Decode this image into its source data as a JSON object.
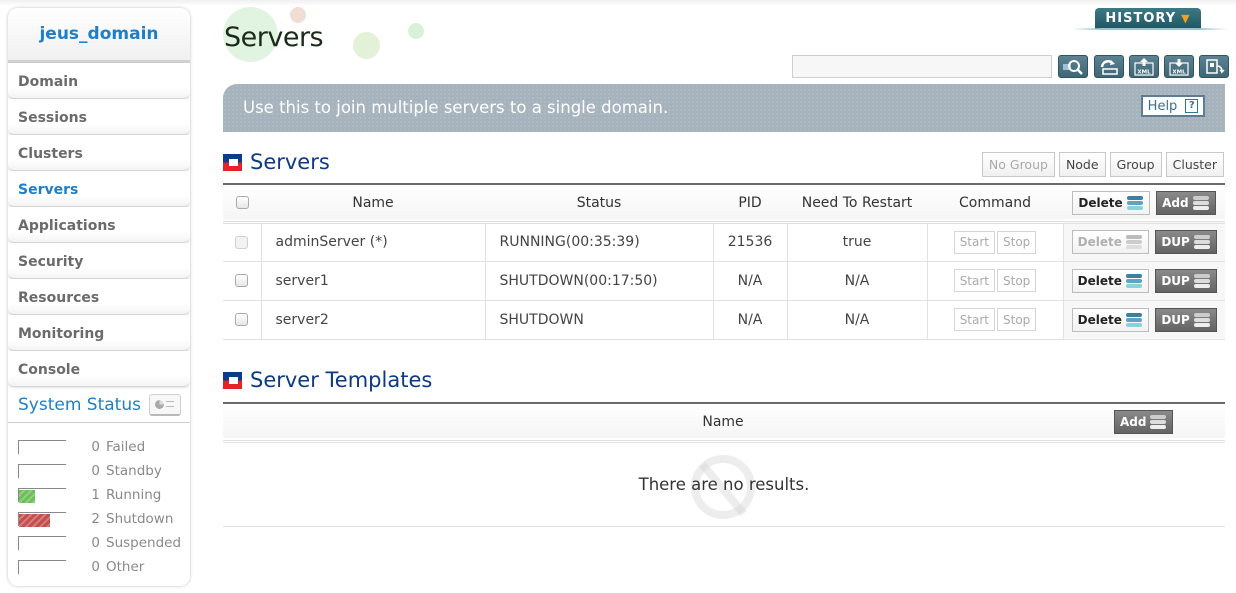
{
  "sidebar": {
    "domain_name": "jeus_domain",
    "items": [
      {
        "label": "Domain",
        "active": false
      },
      {
        "label": "Sessions",
        "active": false
      },
      {
        "label": "Clusters",
        "active": false
      },
      {
        "label": "Servers",
        "active": true
      },
      {
        "label": "Applications",
        "active": false
      },
      {
        "label": "Security",
        "active": false
      },
      {
        "label": "Resources",
        "active": false
      },
      {
        "label": "Monitoring",
        "active": false
      },
      {
        "label": "Console",
        "active": false
      }
    ],
    "system_status": {
      "title": "System Status",
      "icon": "monitor-chart-icon",
      "rows": [
        {
          "count": "0",
          "label": "Failed",
          "fraction": 0,
          "color": "none"
        },
        {
          "count": "0",
          "label": "Standby",
          "fraction": 0,
          "color": "none"
        },
        {
          "count": "1",
          "label": "Running",
          "fraction": 0.333,
          "color": "#6cbf58"
        },
        {
          "count": "2",
          "label": "Shutdown",
          "fraction": 0.667,
          "color": "#c44d4d"
        },
        {
          "count": "0",
          "label": "Suspended",
          "fraction": 0,
          "color": "none"
        },
        {
          "count": "0",
          "label": "Other",
          "fraction": 0,
          "color": "none"
        }
      ]
    }
  },
  "header": {
    "page_title": "Servers",
    "history_label": "HISTORY",
    "search": {
      "value": "",
      "placeholder": ""
    },
    "toolbar": [
      {
        "icon": "search-icon"
      },
      {
        "icon": "refresh-icon"
      },
      {
        "icon": "xml-export-icon",
        "text": "XML"
      },
      {
        "icon": "xml-import-icon",
        "text": "XML"
      },
      {
        "icon": "apply-changes-icon"
      }
    ]
  },
  "banner": {
    "text": "Use this to join multiple servers to a single domain.",
    "help_label": "Help",
    "help_icon": "?"
  },
  "servers_section": {
    "title": "Servers",
    "group_buttons": [
      {
        "label": "No Group",
        "disabled": true
      },
      {
        "label": "Node",
        "disabled": false
      },
      {
        "label": "Group",
        "disabled": false
      },
      {
        "label": "Cluster",
        "disabled": false
      }
    ],
    "columns": [
      "Name",
      "Status",
      "PID",
      "Need To Restart",
      "Command"
    ],
    "delete_label": "Delete",
    "add_label": "Add",
    "start_label": "Start",
    "stop_label": "Stop",
    "dup_label": "DUP",
    "rows": [
      {
        "name": "adminServer (*)",
        "status": "RUNNING(00:35:39)",
        "pid": "21536",
        "need_restart": "true",
        "checkbox_disabled": true,
        "delete_disabled": true
      },
      {
        "name": "server1",
        "status": "SHUTDOWN(00:17:50)",
        "pid": "N/A",
        "need_restart": "N/A",
        "checkbox_disabled": false,
        "delete_disabled": false
      },
      {
        "name": "server2",
        "status": "SHUTDOWN",
        "pid": "N/A",
        "need_restart": "N/A",
        "checkbox_disabled": false,
        "delete_disabled": false
      }
    ]
  },
  "templates_section": {
    "title": "Server Templates",
    "column_name": "Name",
    "add_label": "Add",
    "empty_text": "There are no results."
  },
  "colors": {
    "accent_blue": "#1e7fc8",
    "section_title": "#0d3a82",
    "banner_bg": "#a6b3bd",
    "history_bg": "#1f5662"
  }
}
